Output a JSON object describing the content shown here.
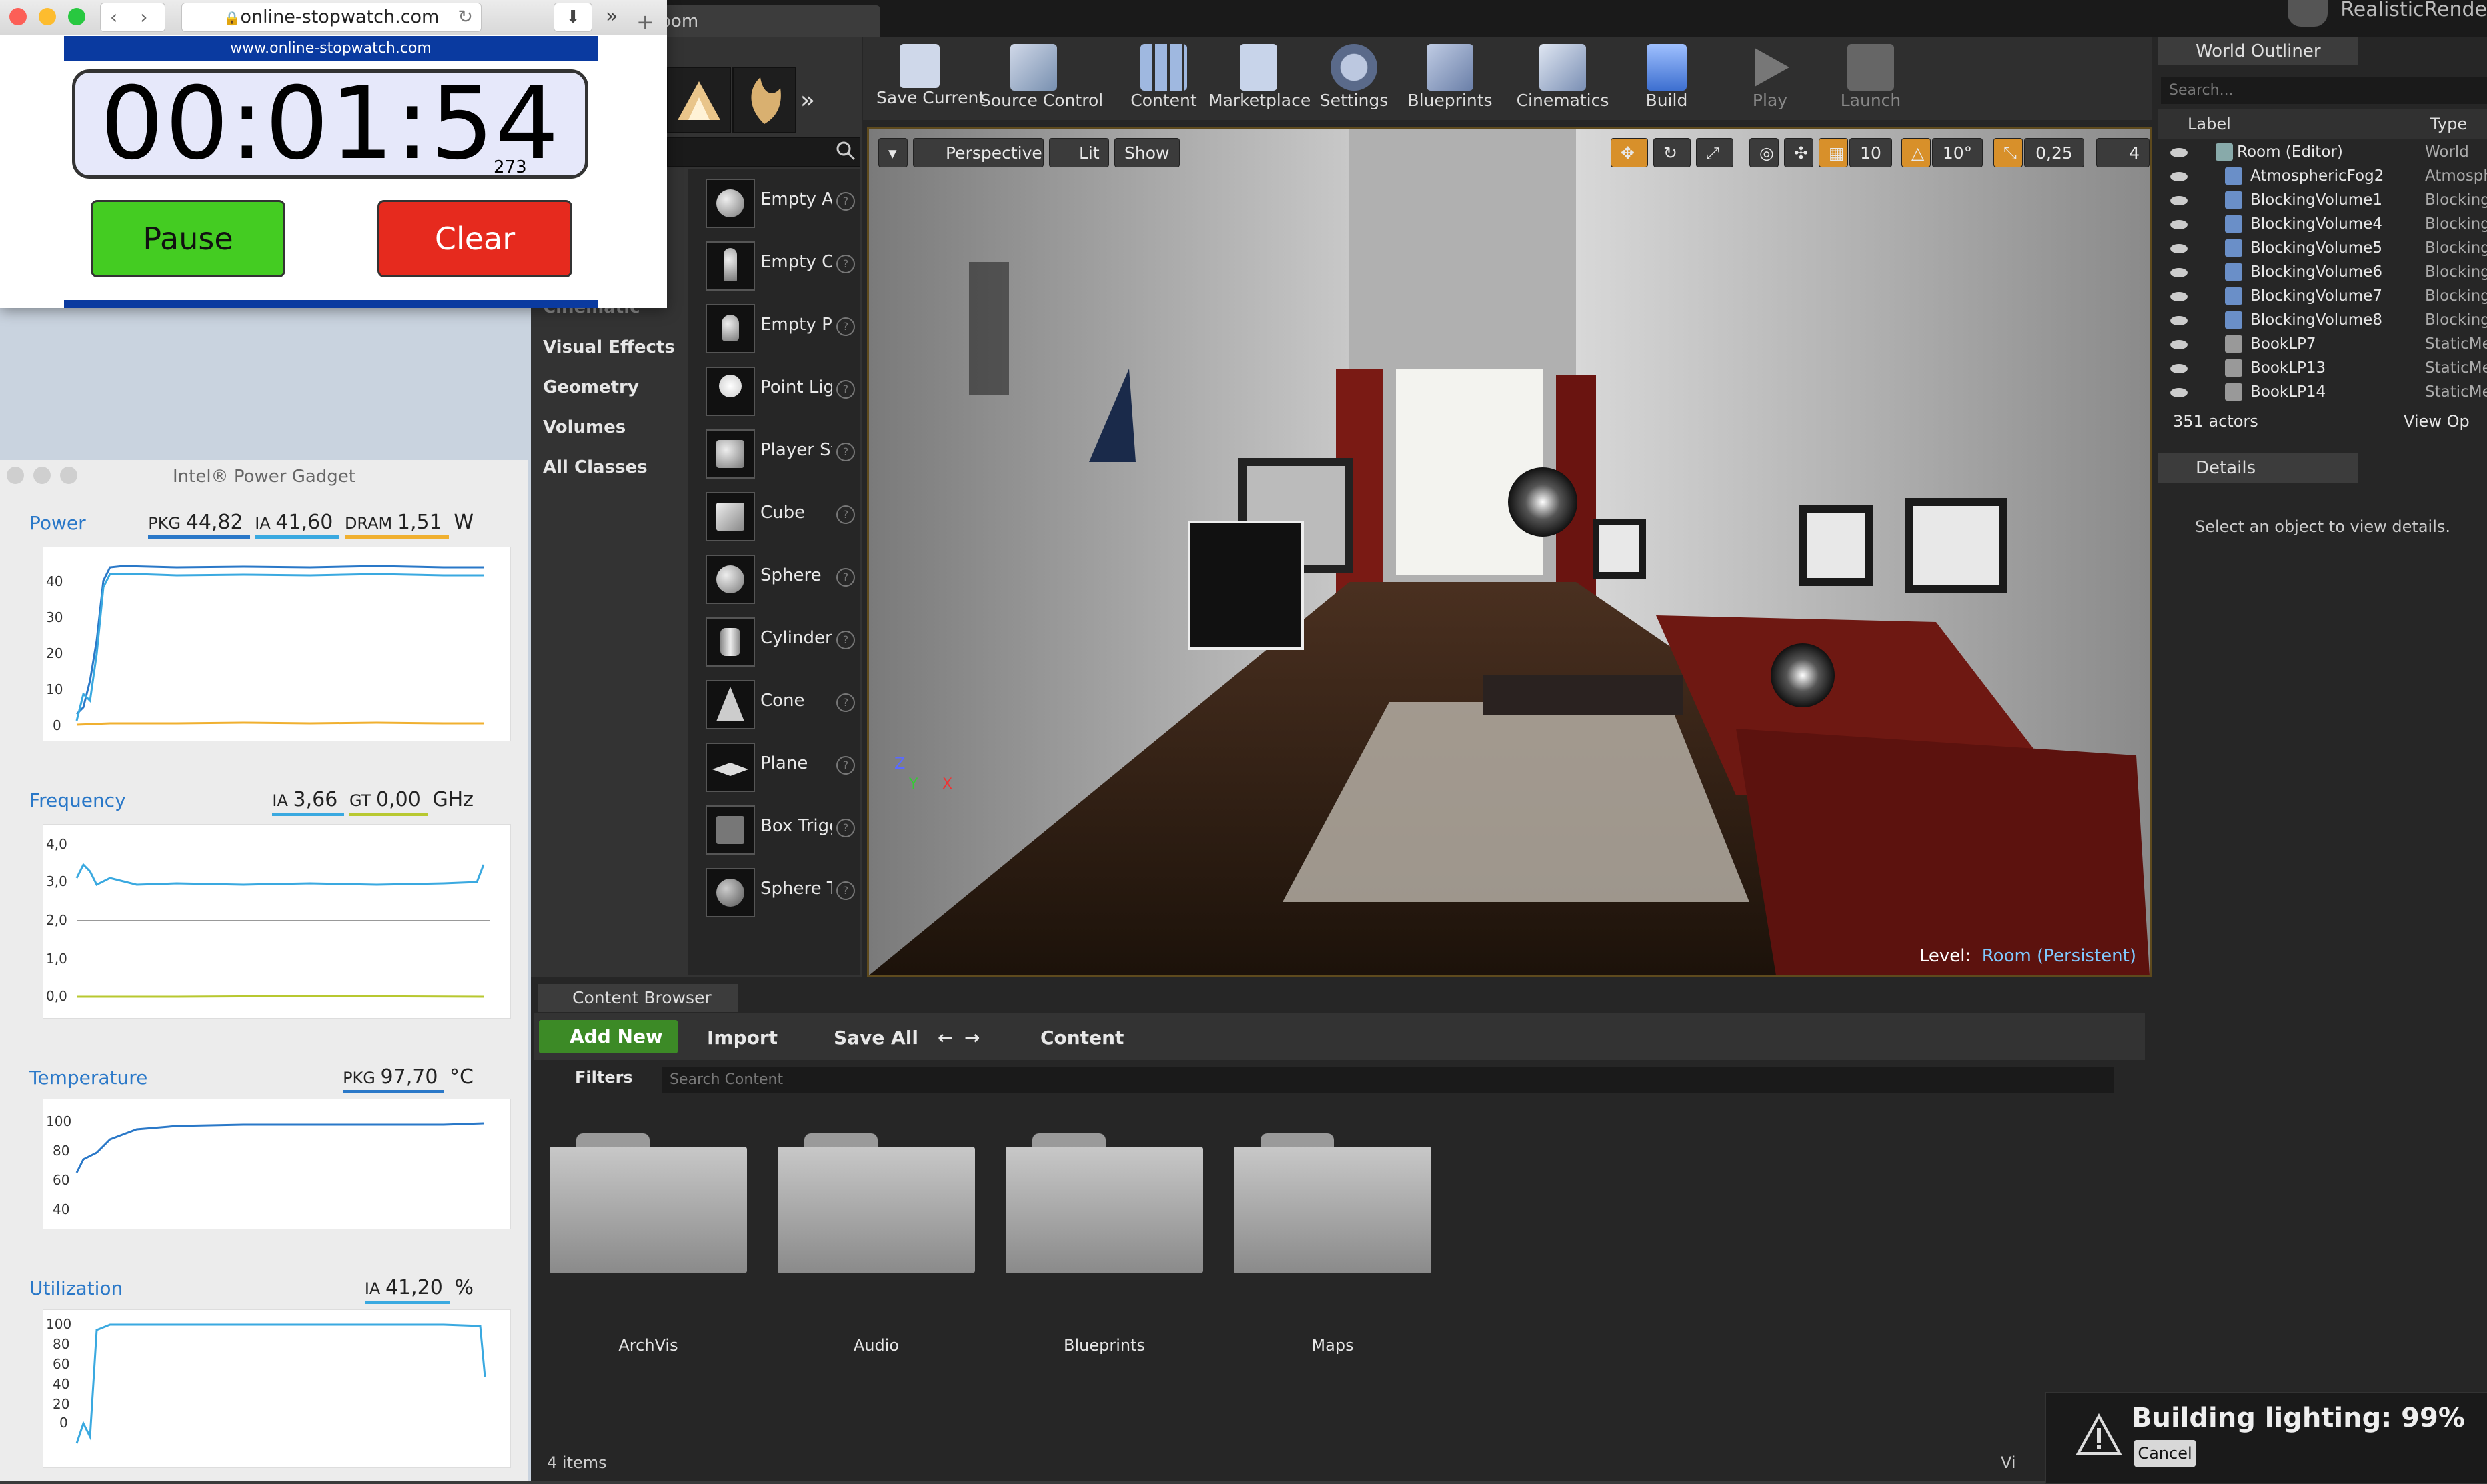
{
  "stopwatch": {
    "url": "online-stopwatch.com",
    "banner": "www.online-stopwatch.com",
    "time": "00:01:54",
    "ms": "273",
    "pause_label": "Pause",
    "clear_label": "Clear"
  },
  "power_gadget": {
    "title": "Intel® Power Gadget",
    "sections": [
      {
        "name": "Power",
        "metrics": [
          {
            "k": "PKG",
            "v": "44,82",
            "color": "#2a78c8"
          },
          {
            "k": "IA",
            "v": "41,60",
            "color": "#3aa9e0"
          },
          {
            "k": "DRAM",
            "v": "1,51",
            "color": "#f0b030"
          }
        ],
        "unit": "W",
        "yticks": [
          "40",
          "30",
          "20",
          "10",
          "0"
        ]
      },
      {
        "name": "Frequency",
        "metrics": [
          {
            "k": "IA",
            "v": "3,66",
            "color": "#3aa9e0"
          },
          {
            "k": "GT",
            "v": "0,00",
            "color": "#b8c830"
          }
        ],
        "unit": "GHz",
        "yticks": [
          "4,0",
          "3,0",
          "2,0",
          "1,0",
          "0,0"
        ]
      },
      {
        "name": "Temperature",
        "metrics": [
          {
            "k": "PKG",
            "v": "97,70",
            "color": "#2a78c8"
          }
        ],
        "unit": "°C",
        "yticks": [
          "100",
          "80",
          "60",
          "40"
        ]
      },
      {
        "name": "Utilization",
        "metrics": [
          {
            "k": "IA",
            "v": "41,20",
            "color": "#3aa9e0"
          }
        ],
        "unit": "%",
        "yticks": [
          "100",
          "80",
          "60",
          "40",
          "20",
          "0"
        ]
      }
    ]
  },
  "editor": {
    "app_title": "RealisticRende",
    "tab_label": "oom",
    "modes_categories": [
      "Cinematic",
      "Visual Effects",
      "Geometry",
      "Volumes",
      "All Classes"
    ],
    "place_items": [
      "Empty Actor",
      "Empty Character",
      "Empty Pawn",
      "Point Light",
      "Player Start",
      "Cube",
      "Sphere",
      "Cylinder",
      "Cone",
      "Plane",
      "Box Trigger",
      "Sphere Trigger"
    ],
    "toolbar": [
      {
        "label": "Save Current",
        "icon": "save-icon",
        "enabled": true
      },
      {
        "label": "Source Control",
        "icon": "source-control-icon",
        "enabled": true
      },
      {
        "label": "Content",
        "icon": "content-icon",
        "enabled": true
      },
      {
        "label": "Marketplace",
        "icon": "marketplace-icon",
        "enabled": true
      },
      {
        "label": "Settings",
        "icon": "settings-icon",
        "enabled": true
      },
      {
        "label": "Blueprints",
        "icon": "blueprints-icon",
        "enabled": true
      },
      {
        "label": "Cinematics",
        "icon": "cinematics-icon",
        "enabled": true
      },
      {
        "label": "Build",
        "icon": "build-icon",
        "enabled": true
      },
      {
        "label": "Play",
        "icon": "play-icon",
        "enabled": false
      },
      {
        "label": "Launch",
        "icon": "launch-icon",
        "enabled": false
      }
    ],
    "viewport": {
      "perspective": "Perspective",
      "lit": "Lit",
      "show": "Show",
      "grid_snap": "10",
      "rot_snap": "10°",
      "scale_snap": "0,25",
      "cam_speed": "4",
      "level_label": "Level:",
      "level_name": "Room (Persistent)"
    },
    "outliner": {
      "tab": "World Outliner",
      "search_placeholder": "Search...",
      "col_label": "Label",
      "col_type": "Type",
      "rows": [
        {
          "label": "Room (Editor)",
          "type": "World"
        },
        {
          "label": "AtmosphericFog2",
          "type": "Atmosph"
        },
        {
          "label": "BlockingVolume1",
          "type": "Blocking"
        },
        {
          "label": "BlockingVolume4",
          "type": "Blocking"
        },
        {
          "label": "BlockingVolume5",
          "type": "Blocking"
        },
        {
          "label": "BlockingVolume6",
          "type": "Blocking"
        },
        {
          "label": "BlockingVolume7",
          "type": "Blocking"
        },
        {
          "label": "BlockingVolume8",
          "type": "Blocking"
        },
        {
          "label": "BookLP7",
          "type": "StaticMe"
        },
        {
          "label": "BookLP13",
          "type": "StaticMe"
        },
        {
          "label": "BookLP14",
          "type": "StaticMe"
        }
      ],
      "count": "351 actors",
      "view_options": "View Op"
    },
    "details": {
      "tab": "Details",
      "message": "Select an object to view details."
    },
    "content_browser": {
      "tab": "Content Browser",
      "add_new": "Add New",
      "import": "Import",
      "save_all": "Save All",
      "path": "Content",
      "filters": "Filters",
      "search_placeholder": "Search Content",
      "folders": [
        "ArchVis",
        "Audio",
        "Blueprints",
        "Maps"
      ],
      "count": "4 items",
      "view_options": "Vi"
    },
    "toast": {
      "title": "Building lighting:  99%",
      "cancel": "Cancel"
    }
  }
}
